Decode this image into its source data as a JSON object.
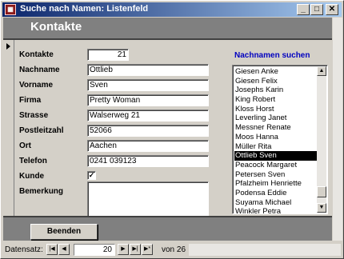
{
  "window": {
    "title": "Suche nach Namen: Listenfeld"
  },
  "titlebar_buttons": {
    "minimize": "_",
    "maximize": "□",
    "close": "✕"
  },
  "header": {
    "title": "Kontakte"
  },
  "fields": {
    "kontakt": {
      "label": "Kontakte",
      "value": "21"
    },
    "nachname": {
      "label": "Nachname",
      "value": "Ottlieb"
    },
    "vorname": {
      "label": "Vorname",
      "value": "Sven"
    },
    "firma": {
      "label": "Firma",
      "value": "Pretty Woman"
    },
    "strasse": {
      "label": "Strasse",
      "value": "Walserweg 21"
    },
    "postleitzahl": {
      "label": "Postleitzahl",
      "value": "52066"
    },
    "ort": {
      "label": "Ort",
      "value": "Aachen"
    },
    "telefon": {
      "label": "Telefon",
      "value": "0241 039123"
    },
    "kunde": {
      "label": "Kunde",
      "checked": true,
      "mark": "✓"
    },
    "bemerkung": {
      "label": "Bemerkung",
      "value": ""
    }
  },
  "search": {
    "label": "Nachnamen suchen",
    "items": [
      "Giesen Anke",
      "Giesen Felix",
      "Josephs Karin",
      "King Robert",
      "Kloss Horst",
      "Leverling Janet",
      "Messner Renate",
      "Moos Hanna",
      "Müller Rita",
      "Ottlieb Sven",
      "Peacock Margaret",
      "Petersen Sven",
      "Pfalzheim Henriette",
      "Podensa Eddie",
      "Suyama Michael",
      "Winkler Petra"
    ],
    "selected_index": 9
  },
  "footer": {
    "close_button": "Beenden"
  },
  "navigation": {
    "label": "Datensatz:",
    "first": "|◀",
    "prev": "◀",
    "next": "▶",
    "last": "▶|",
    "new": "▶*",
    "current": "20",
    "total_text": "von  26"
  },
  "icons": {
    "up": "▲",
    "down": "▼"
  }
}
